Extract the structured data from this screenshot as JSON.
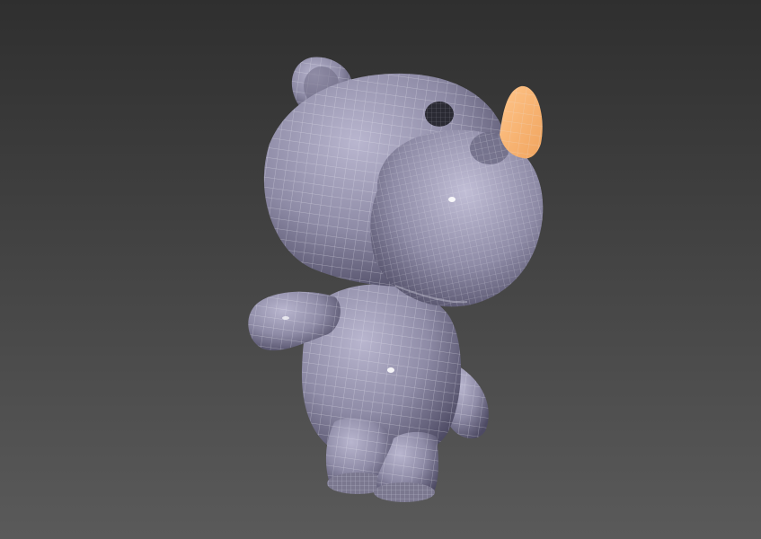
{
  "viewport": {
    "background_top": "#2f2f2f",
    "background_bottom": "#5a5a5a",
    "model": {
      "subject": "rhino-character",
      "body_color": "#8e8ba6",
      "body_highlight": "#b9b6cf",
      "body_shadow": "#4d4a63",
      "horn_color": "#f0a45e",
      "horn_highlight": "#ffc58a",
      "wire_color": "#e6e6f0"
    }
  }
}
